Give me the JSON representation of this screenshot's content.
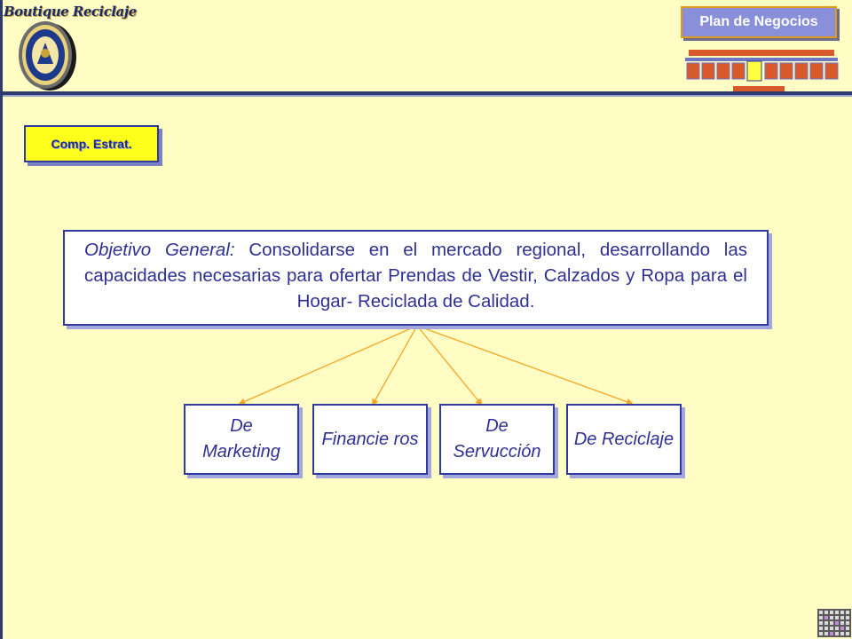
{
  "header": {
    "logo_text": "Boutique Reciclaje",
    "nav_button_label": "Plan de Negocios"
  },
  "section_button_label": "Comp. Estrat.",
  "objective": {
    "label": "Objetivo General:",
    "text": " Consolidarse en el mercado regional, desarrollando las capacidades necesarias para ofertar Prendas de Vestir, Calzados y Ropa para el Hogar- Reciclada de Calidad."
  },
  "sub_objectives": [
    {
      "label": "De Marketing"
    },
    {
      "label": "Financie ros"
    },
    {
      "label": "De Servucción"
    },
    {
      "label": "De Reciclaje"
    }
  ],
  "colors": {
    "background": "#fffdc4",
    "box_border": "#2e3a9e",
    "box_text": "#2e3192",
    "connector": "#f5a623",
    "nav_button": "#8a8fd9",
    "section_button": "#ffff1c"
  }
}
